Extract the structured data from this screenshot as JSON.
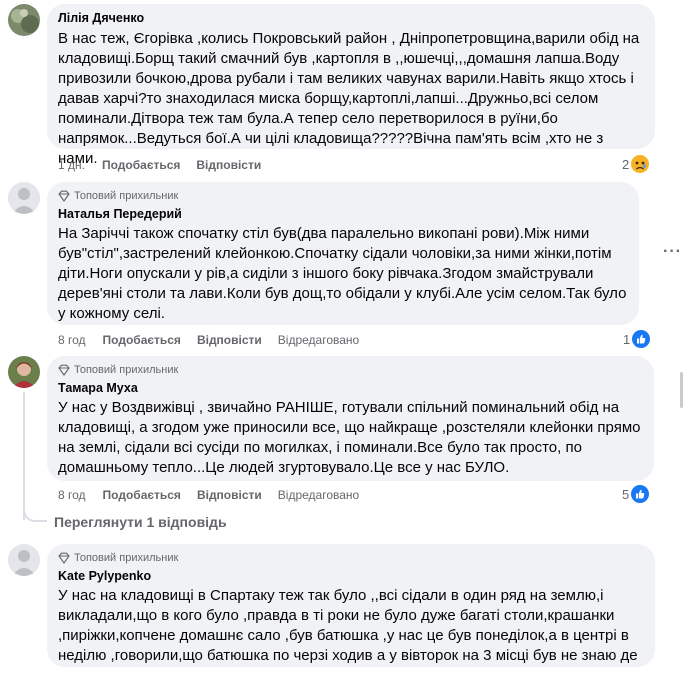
{
  "comments": [
    {
      "author": "Лілія Дяченко",
      "badge": "",
      "text": "В нас теж, Єгорівка ,колись Покровський район , Дніпропетровщина,варили обід на кладовищі.Борщ такий смачний був ,картопля в ,,юшечці,,,домашня лапша.Воду привозили бочкою,дрова рубали і там великих чавунах варили.Навіть якщо хтось і давав харчі?то знаходилася миска борщу,картоплі,лапші...Дружньо,всі селом поминали.Дітвора теж там була.А тепер село перетворилося в руїни,бо напрямок...Ведуться бої.А чи цілі кладовища?????Вічна пам'ять всім ,хто не з нами.",
      "time": "1 дн.",
      "like": "Подобається",
      "reply": "Відповісти",
      "edited": "",
      "reaction_count": "2",
      "reaction_icon": "sad-reaction-icon"
    },
    {
      "author": "Наталья Передерий",
      "badge": "Топовий прихильник",
      "text": "На Заріччі також спочатку стіл був(два паралельно викопані рови).Між ними був\"стіл\",застрелений клейонкою.Спочатку сідали чоловіки,за ними жінки,потім діти.Ноги опускали у рів,а сиділи з іншого боку рівчака.Згодом змайстрували дерев'яні столи та лави.Коли був дощ,то обідали у клубі.Але усім селом.Так було у кожному селі.",
      "time": "8 год",
      "like": "Подобається",
      "reply": "Відповісти",
      "edited": "Відредаговано",
      "reaction_count": "1",
      "reaction_icon": "like-reaction-icon"
    },
    {
      "author": "Тамара Муха",
      "badge": "Топовий прихильник",
      "text": "У нас у Воздвижівці , звичайно РАНІШЕ, готували спільний поминальний обід на кладовищі, а згодом уже приносили все, що найкраще ,розстеляли клейонки прямо на землі, сідали всі сусіди по могилках, і поминали.Все було так просто, по домашньому тепло...Це людей згуртовувало.Це все у нас БУЛО.",
      "time": "8 год",
      "like": "Подобається",
      "reply": "Відповісти",
      "edited": "Відредаговано",
      "reaction_count": "5",
      "reaction_icon": "like-reaction-icon"
    },
    {
      "author": "Kate Pylypenko",
      "badge": "Топовий прихильник",
      "text": "У нас на кладовищі в Спартаку теж так було ,,всі сідали в один ряд на землю,і викладали,що в кого було ,правда в ті роки не було дуже багаті столи,крашанки ,пиріжки,копчене домашнє сало ,був батюшка ,у нас це був понеділок,а в центрі в неділю ,говорили,що батюшка по черзі ходив а у вівторок на 3 місці був не знаю де",
      "time": "",
      "like": "",
      "reply": "",
      "edited": "",
      "reaction_count": "",
      "reaction_icon": ""
    }
  ],
  "view_replies": "Переглянути 1 відповідь",
  "more_options": "···",
  "colors": {
    "bubble": "#f0f2f5",
    "meta_text": "#65676b",
    "like_blue": "#1877f2",
    "sad_yellow": "#f7b125"
  }
}
